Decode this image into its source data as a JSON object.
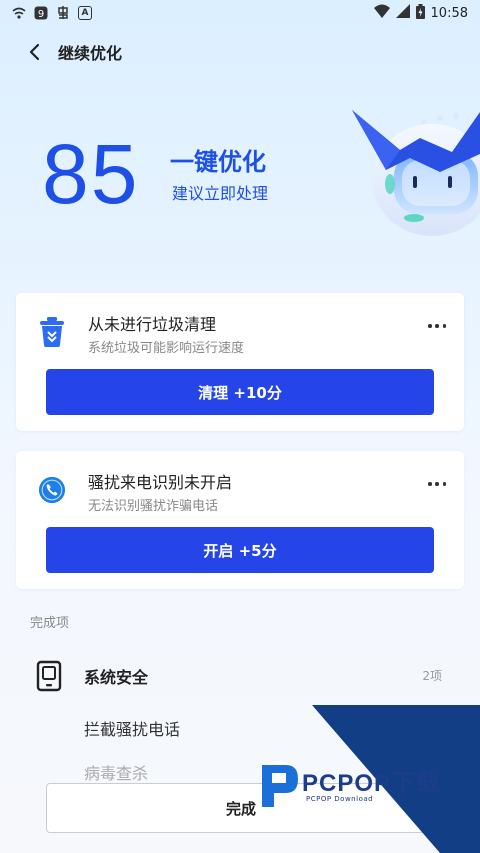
{
  "status_bar": {
    "time": "10:58",
    "left_icons": [
      "wifi-lock-icon",
      "app-9-icon",
      "bug-app-icon",
      "a-box-icon"
    ],
    "right_icons": [
      "wifi-icon",
      "signal-icon",
      "battery-icon"
    ]
  },
  "nav": {
    "title": "继续优化"
  },
  "hero": {
    "score": "85",
    "title": "一键优化",
    "subtitle": "建议立即处理"
  },
  "cards": [
    {
      "icon": "trash-bin-icon",
      "title": "从未进行垃圾清理",
      "subtitle": "系统垃圾可能影响运行速度",
      "button": "清理 +10分"
    },
    {
      "icon": "phone-shield-icon",
      "title": "骚扰来电识别未开启",
      "subtitle": "无法识别骚扰诈骗电话",
      "button": "开启 +5分"
    }
  ],
  "completed": {
    "section_label": "完成项",
    "item_title": "系统安全",
    "item_count": "2项",
    "sub_items": [
      "拦截骚扰电话",
      "病毒查杀"
    ]
  },
  "footer": {
    "finish_button": "完成"
  },
  "watermark": {
    "brand": "PCPOP下载",
    "sub": "PCPOP Download"
  },
  "colors": {
    "accent": "#2545e8",
    "score_blue": "#1e4fe6"
  }
}
